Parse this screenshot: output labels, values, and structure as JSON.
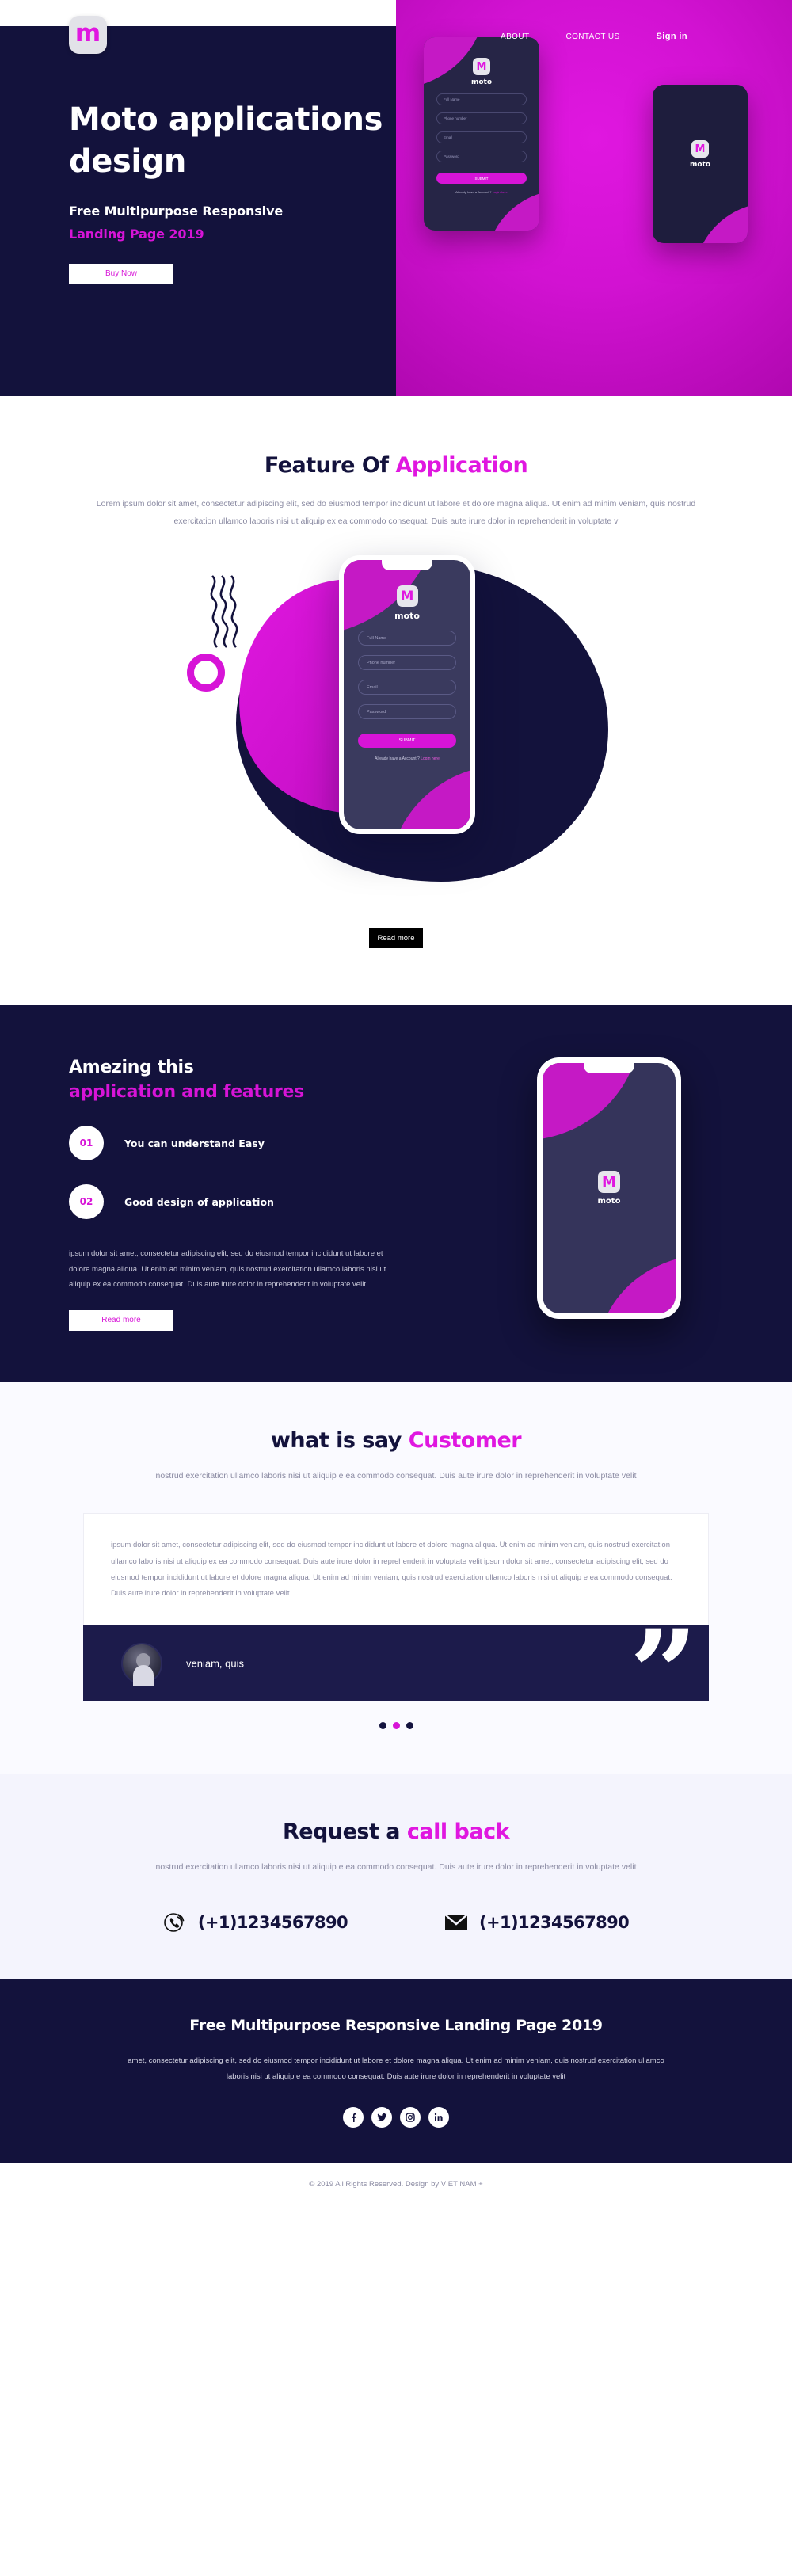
{
  "brand": {
    "logo_letter": "m",
    "name": "moto"
  },
  "nav": {
    "items": [
      {
        "label": "ABOUT"
      },
      {
        "label": "CONTACT US"
      },
      {
        "label": "Sign in"
      }
    ]
  },
  "hero": {
    "title": "Moto applications design",
    "subtitle": "Free Multipurpose Responsive",
    "subtitle_accent": "Landing Page 2019",
    "cta_label": "Buy Now"
  },
  "phone_form": {
    "logo_letter": "M",
    "app_name": "moto",
    "fields": [
      {
        "placeholder": "Full Name"
      },
      {
        "placeholder": "Phone number"
      },
      {
        "placeholder": "Email"
      },
      {
        "placeholder": "Password"
      }
    ],
    "submit_label": "SUBMIT",
    "footer_text": "Already have a Account ?",
    "footer_link": "Login here"
  },
  "feature": {
    "title_plain": "Feature Of ",
    "title_accent": "Application",
    "paragraph": "Lorem ipsum dolor sit amet, consectetur adipiscing elit, sed do eiusmod tempor incididunt ut labore et dolore magna aliqua. Ut enim ad minim veniam, quis nostrud exercitation ullamco laboris nisi ut aliquip ex ea commodo consequat. Duis aute irure dolor in reprehenderit in voluptate v",
    "cta_label": "Read more"
  },
  "amezing": {
    "title_line1": "Amezing this",
    "title_line2": "application and features",
    "items": [
      {
        "number": "01",
        "label": "You can understand Easy"
      },
      {
        "number": "02",
        "label": "Good design of application"
      }
    ],
    "paragraph": "ipsum dolor sit amet, consectetur adipiscing elit, sed do eiusmod tempor incididunt ut labore et dolore magna aliqua. Ut enim ad minim veniam, quis nostrud exercitation ullamco laboris nisi ut aliquip ex ea commodo consequat. Duis aute irure dolor in reprehenderit in voluptate velit",
    "cta_label": "Read more"
  },
  "testimonial": {
    "title_plain": "what is say ",
    "title_accent": "Customer",
    "subtitle": "nostrud exercitation ullamco laboris nisi ut aliquip e ea commodo consequat. Duis aute irure dolor in reprehenderit in voluptate velit",
    "quote": "ipsum dolor sit amet, consectetur adipiscing elit, sed do eiusmod tempor incididunt ut labore et dolore magna aliqua. Ut enim ad minim veniam, quis nostrud exercitation ullamco laboris nisi ut aliquip ex ea commodo consequat. Duis aute irure dolor in reprehenderit in voluptate velit ipsum dolor sit amet, consectetur adipiscing elit, sed do eiusmod tempor incididunt ut labore et dolore magna aliqua. Ut enim ad minim veniam, quis nostrud exercitation ullamco laboris nisi ut aliquip e ea commodo consequat. Duis aute irure dolor in reprehenderit in voluptate velit",
    "author": "veniam, quis",
    "dots_count": 3,
    "active_dot": 1
  },
  "callback": {
    "title_plain": "Request a ",
    "title_accent": "call back",
    "subtitle": "nostrud exercitation ullamco laboris nisi ut aliquip e ea commodo consequat. Duis aute irure dolor in reprehenderit in voluptate velit",
    "phone": "(+1)1234567890",
    "email_phone": "(+1)1234567890"
  },
  "footer": {
    "title": "Free Multipurpose Responsive Landing Page 2019",
    "paragraph": "amet, consectetur adipiscing elit, sed do eiusmod tempor incididunt ut labore et dolore magna aliqua. Ut enim ad minim veniam, quis nostrud exercitation ullamco laboris nisi ut aliquip e ea commodo consequat. Duis aute irure dolor in reprehenderit in voluptate velit",
    "socials": [
      {
        "name": "facebook",
        "glyph": "f"
      },
      {
        "name": "twitter",
        "glyph": "⤵"
      },
      {
        "name": "instagram",
        "glyph": "▣"
      },
      {
        "name": "linkedin",
        "glyph": "in"
      }
    ],
    "copyright": "© 2019 All Rights Reserved. Design by VIET NAM +"
  },
  "colors": {
    "navy": "#13123c",
    "magenta": "#d714d7",
    "magenta_bright": "#e017e0",
    "muted_text": "#8b8ba3"
  }
}
